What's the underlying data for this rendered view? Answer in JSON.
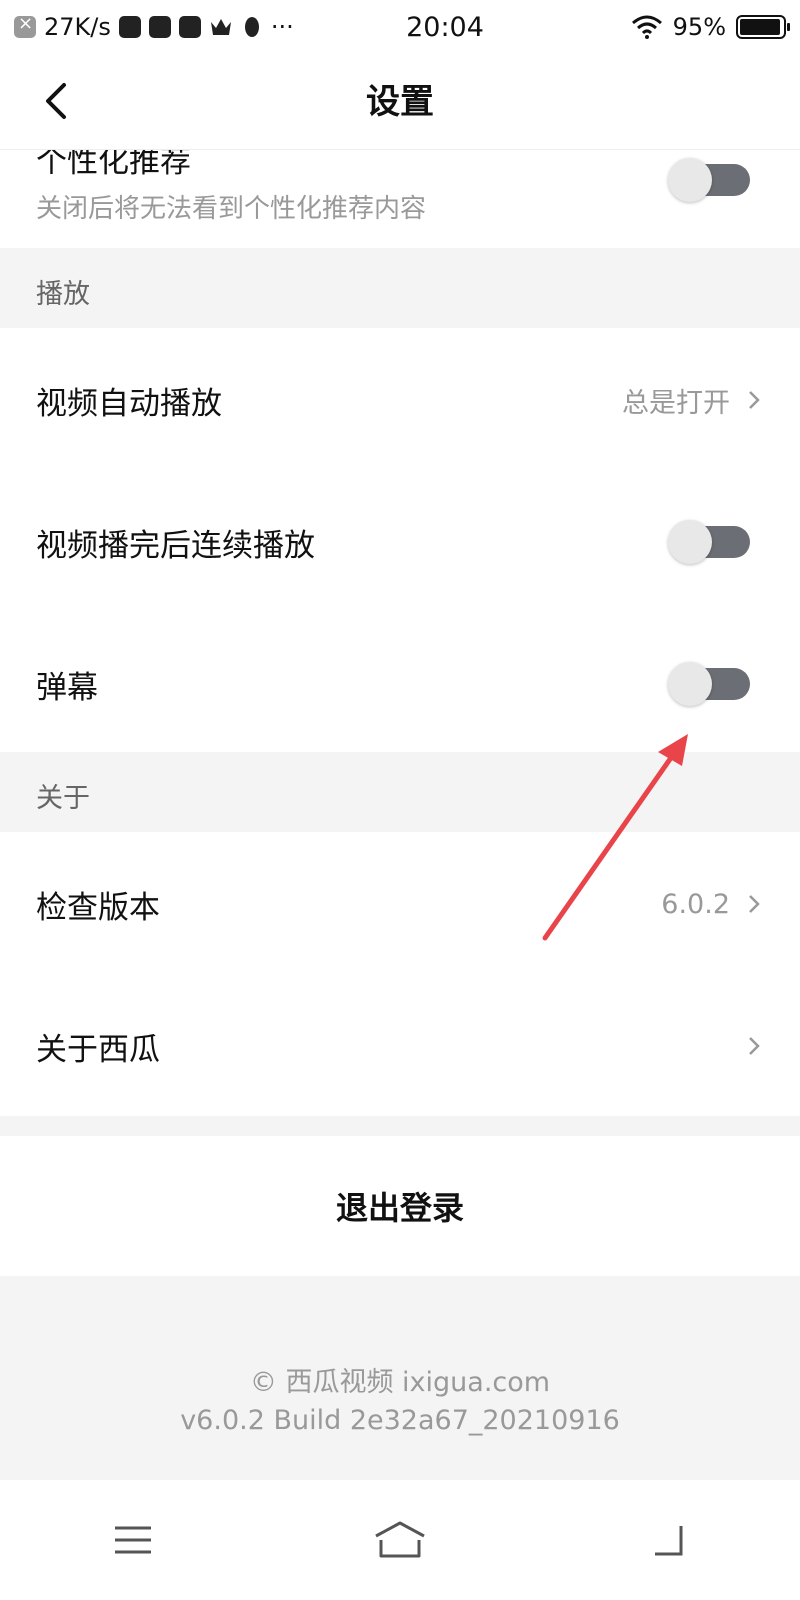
{
  "status_bar": {
    "net_speed": "27K/s",
    "more": "···",
    "time": "20:04",
    "battery_percent": "95%",
    "battery_level": 0.95
  },
  "header": {
    "title": "设置"
  },
  "personalization": {
    "label": "个性化推荐",
    "description": "关闭后将无法看到个性化推荐内容",
    "enabled": false
  },
  "playback": {
    "header": "播放",
    "autoplay_label": "视频自动播放",
    "autoplay_value": "总是打开",
    "continuous_label": "视频播完后连续播放",
    "continuous_enabled": false,
    "danmaku_label": "弹幕",
    "danmaku_enabled": false
  },
  "about": {
    "header": "关于",
    "check_version_label": "检查版本",
    "version_value": "6.0.2",
    "about_label": "关于西瓜"
  },
  "logout_label": "退出登录",
  "footer": {
    "copyright": "© 西瓜视频 ixigua.com",
    "build": "v6.0.2 Build 2e32a67_20210916"
  },
  "colors": {
    "toggle_track": "#6b6e74",
    "annotation_arrow": "#e8444a"
  }
}
